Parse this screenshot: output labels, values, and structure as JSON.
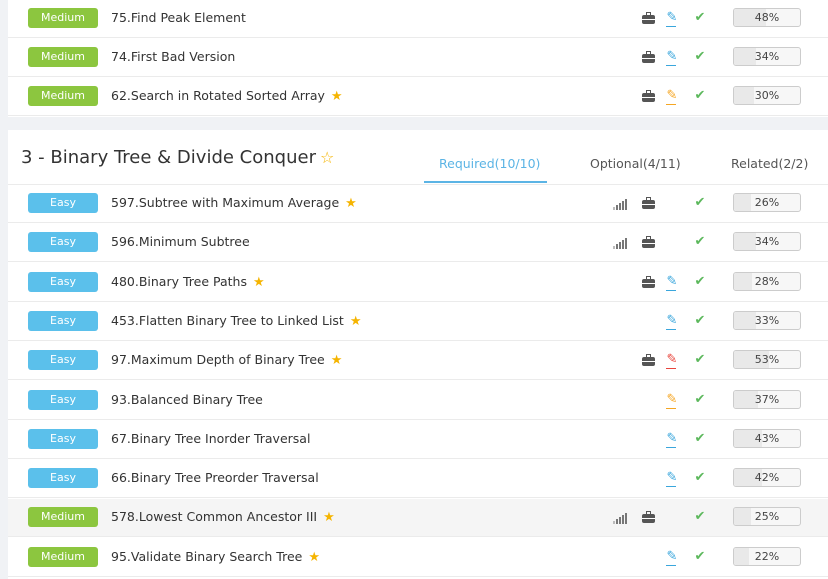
{
  "top_rows": [
    {
      "difficulty": "Medium",
      "title": "75.Find Peak Element",
      "starred": false,
      "signal": false,
      "company": true,
      "pen": "blue",
      "check": true,
      "percent": "48%",
      "fill": 48
    },
    {
      "difficulty": "Medium",
      "title": "74.First Bad Version",
      "starred": false,
      "signal": false,
      "company": true,
      "pen": "blue",
      "check": true,
      "percent": "34%",
      "fill": 34
    },
    {
      "difficulty": "Medium",
      "title": "62.Search in Rotated Sorted Array",
      "starred": true,
      "signal": false,
      "company": true,
      "pen": "orange",
      "check": true,
      "percent": "30%",
      "fill": 30
    }
  ],
  "section": {
    "title": "3 - Binary Tree & Divide Conquer",
    "tabs": [
      {
        "label": "Required(10/10)",
        "active": true
      },
      {
        "label": "Optional(4/11)",
        "active": false
      },
      {
        "label": "Related(2/2)",
        "active": false
      }
    ]
  },
  "rows": [
    {
      "difficulty": "Easy",
      "title": "597.Subtree with Maximum Average",
      "starred": true,
      "signal": true,
      "company": true,
      "pen": null,
      "check": true,
      "percent": "26%",
      "fill": 26
    },
    {
      "difficulty": "Easy",
      "title": "596.Minimum Subtree",
      "starred": false,
      "signal": true,
      "company": true,
      "pen": null,
      "check": true,
      "percent": "34%",
      "fill": 34
    },
    {
      "difficulty": "Easy",
      "title": "480.Binary Tree Paths",
      "starred": true,
      "signal": false,
      "company": true,
      "pen": "blue",
      "check": true,
      "percent": "28%",
      "fill": 28
    },
    {
      "difficulty": "Easy",
      "title": "453.Flatten Binary Tree to Linked List",
      "starred": true,
      "signal": false,
      "company": false,
      "pen": "blue",
      "check": true,
      "percent": "33%",
      "fill": 33
    },
    {
      "difficulty": "Easy",
      "title": "97.Maximum Depth of Binary Tree",
      "starred": true,
      "signal": false,
      "company": true,
      "pen": "red",
      "check": true,
      "percent": "53%",
      "fill": 53
    },
    {
      "difficulty": "Easy",
      "title": "93.Balanced Binary Tree",
      "starred": false,
      "signal": false,
      "company": false,
      "pen": "orange",
      "check": true,
      "percent": "37%",
      "fill": 37
    },
    {
      "difficulty": "Easy",
      "title": "67.Binary Tree Inorder Traversal",
      "starred": false,
      "signal": false,
      "company": false,
      "pen": "blue",
      "check": true,
      "percent": "43%",
      "fill": 43
    },
    {
      "difficulty": "Easy",
      "title": "66.Binary Tree Preorder Traversal",
      "starred": false,
      "signal": false,
      "company": false,
      "pen": "blue",
      "check": true,
      "percent": "42%",
      "fill": 42
    },
    {
      "difficulty": "Medium",
      "title": "578.Lowest Common Ancestor III",
      "starred": true,
      "signal": true,
      "company": true,
      "pen": null,
      "check": true,
      "percent": "25%",
      "fill": 25,
      "highlight": true
    },
    {
      "difficulty": "Medium",
      "title": "95.Validate Binary Search Tree",
      "starred": true,
      "signal": false,
      "company": false,
      "pen": "blue",
      "check": true,
      "percent": "22%",
      "fill": 22
    }
  ],
  "icons": {
    "star": "star-icon",
    "signal": "signal-icon",
    "company": "briefcase-icon",
    "pen": "pencil-icon",
    "check": "check-icon"
  },
  "colors": {
    "medium": "#8cc63f",
    "easy": "#5bc0eb",
    "accent": "#5bb4e5",
    "star": "#f5b400",
    "check": "#5cb85c"
  }
}
